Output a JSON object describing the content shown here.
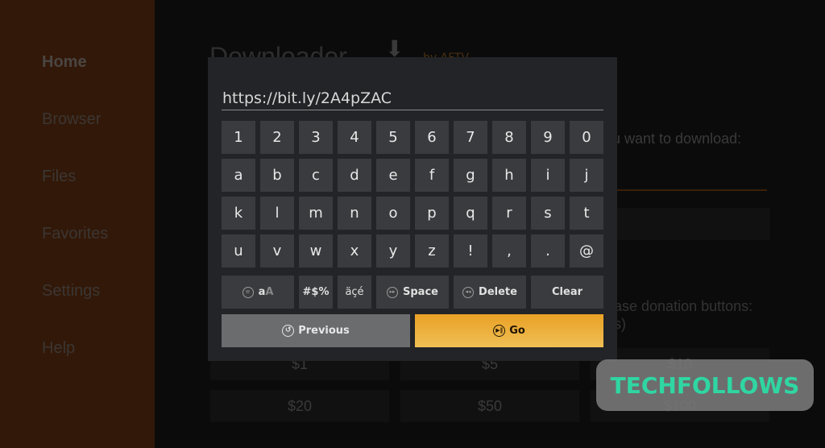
{
  "sidebar": {
    "items": [
      {
        "label": "Home",
        "active": true
      },
      {
        "label": "Browser",
        "active": false
      },
      {
        "label": "Files",
        "active": false
      },
      {
        "label": "Favorites",
        "active": false
      },
      {
        "label": "Settings",
        "active": false
      },
      {
        "label": "Help",
        "active": false
      }
    ]
  },
  "background": {
    "app_title": "Downloader",
    "subtitle": "by AFTV",
    "url_prompt": "u want to download:",
    "donation_prompt_line1": "ase donation buttons:",
    "donation_prompt_line2": "s)",
    "donations": [
      "$1",
      "$5",
      "$10",
      "$20",
      "$50",
      "$100"
    ]
  },
  "keyboard": {
    "url_value": "https://bit.ly/2A4pZAC",
    "rows": [
      [
        "1",
        "2",
        "3",
        "4",
        "5",
        "6",
        "7",
        "8",
        "9",
        "0"
      ],
      [
        "a",
        "b",
        "c",
        "d",
        "e",
        "f",
        "g",
        "h",
        "i",
        "j"
      ],
      [
        "k",
        "l",
        "m",
        "n",
        "o",
        "p",
        "q",
        "r",
        "s",
        "t"
      ],
      [
        "u",
        "v",
        "w",
        "x",
        "y",
        "z",
        "!",
        ",",
        ".",
        "@"
      ]
    ],
    "function_keys": {
      "case_lower": "a",
      "case_upper": "A",
      "symbols": "#$%",
      "accents": "äçé",
      "space": "Space",
      "delete": "Delete",
      "clear": "Clear"
    },
    "previous_label": "Previous",
    "go_label": "Go"
  },
  "watermark": {
    "text": "TECHFOLLOWS"
  },
  "colors": {
    "accent": "#e9a125",
    "sidebar_bg": "#321808",
    "dialog_bg": "#232427",
    "key_bg": "#3a3b3e",
    "watermark_text": "#2fd6a2"
  }
}
